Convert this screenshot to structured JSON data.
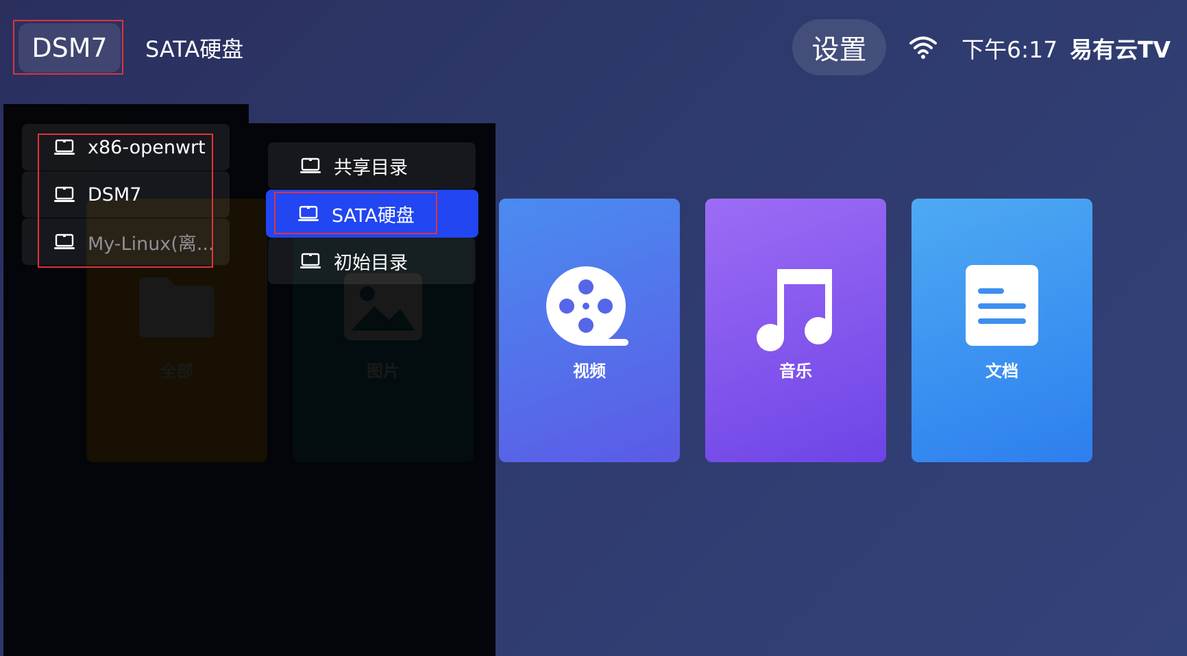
{
  "breadcrumb": {
    "current": "DSM7",
    "next": "SATA硬盘"
  },
  "header": {
    "settings_label": "设置",
    "time": "下午6:17",
    "brand": "易有云TV",
    "wifi_icon": "wifi-icon"
  },
  "categories": [
    {
      "label": "全部",
      "icon": "folder-icon",
      "color": "#e3a020"
    },
    {
      "label": "图片",
      "icon": "image-icon",
      "color": "#1e86a6"
    },
    {
      "label": "视频",
      "icon": "film-reel-icon",
      "color": "#4a8cf0"
    },
    {
      "label": "音乐",
      "icon": "music-note-icon",
      "color": "#9d6cf5"
    },
    {
      "label": "文档",
      "icon": "document-icon",
      "color": "#4eaaf3"
    }
  ],
  "devices": [
    {
      "label": "x86-openwrt",
      "icon": "laptop-icon",
      "status": "online"
    },
    {
      "label": "DSM7",
      "icon": "laptop-icon",
      "status": "online"
    },
    {
      "label": "My-Linux(离...",
      "icon": "laptop-icon",
      "status": "offline"
    }
  ],
  "folders": [
    {
      "label": "共享目录",
      "icon": "laptop-icon",
      "selected": false
    },
    {
      "label": "SATA硬盘",
      "icon": "laptop-icon",
      "selected": true
    },
    {
      "label": "初始目录",
      "icon": "laptop-icon",
      "selected": false
    }
  ],
  "colors": {
    "selected_bg": "#2146f2",
    "highlight_border": "#e0343a"
  }
}
